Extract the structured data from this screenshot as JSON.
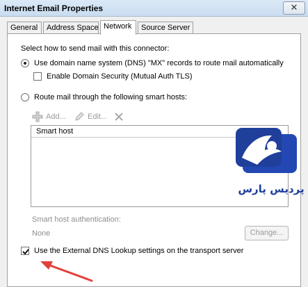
{
  "window": {
    "title": "Internet Email Properties",
    "close_icon": "close-icon"
  },
  "tabs": [
    {
      "label": "General",
      "active": false
    },
    {
      "label": "Address Space",
      "active": false
    },
    {
      "label": "Network",
      "active": true
    },
    {
      "label": "Source Server",
      "active": false
    }
  ],
  "network": {
    "section_label": "Select how to send mail with this connector:",
    "option_dns": {
      "label": "Use domain name system (DNS) \"MX\" records to route mail automatically",
      "selected": true
    },
    "domain_security": {
      "label": "Enable Domain Security (Mutual Auth TLS)",
      "checked": false
    },
    "option_smarthost": {
      "label": "Route mail through the following smart hosts:",
      "selected": false
    },
    "toolbar": {
      "add_label": "Add...",
      "edit_label": "Edit...",
      "add_icon": "add-icon",
      "edit_icon": "edit-pencil-icon",
      "delete_icon": "delete-x-icon"
    },
    "smart_host_list": {
      "column_header": "Smart host",
      "rows": []
    },
    "auth": {
      "label": "Smart host authentication:",
      "value": "None",
      "change_button": "Change..."
    },
    "external_dns": {
      "label": "Use the External DNS Lookup settings on the transport server",
      "checked": true
    }
  },
  "watermark": {
    "text": "پردیس پارس",
    "color": "#1f3f9a"
  },
  "annotation": {
    "arrow_color": "#e2413b"
  }
}
